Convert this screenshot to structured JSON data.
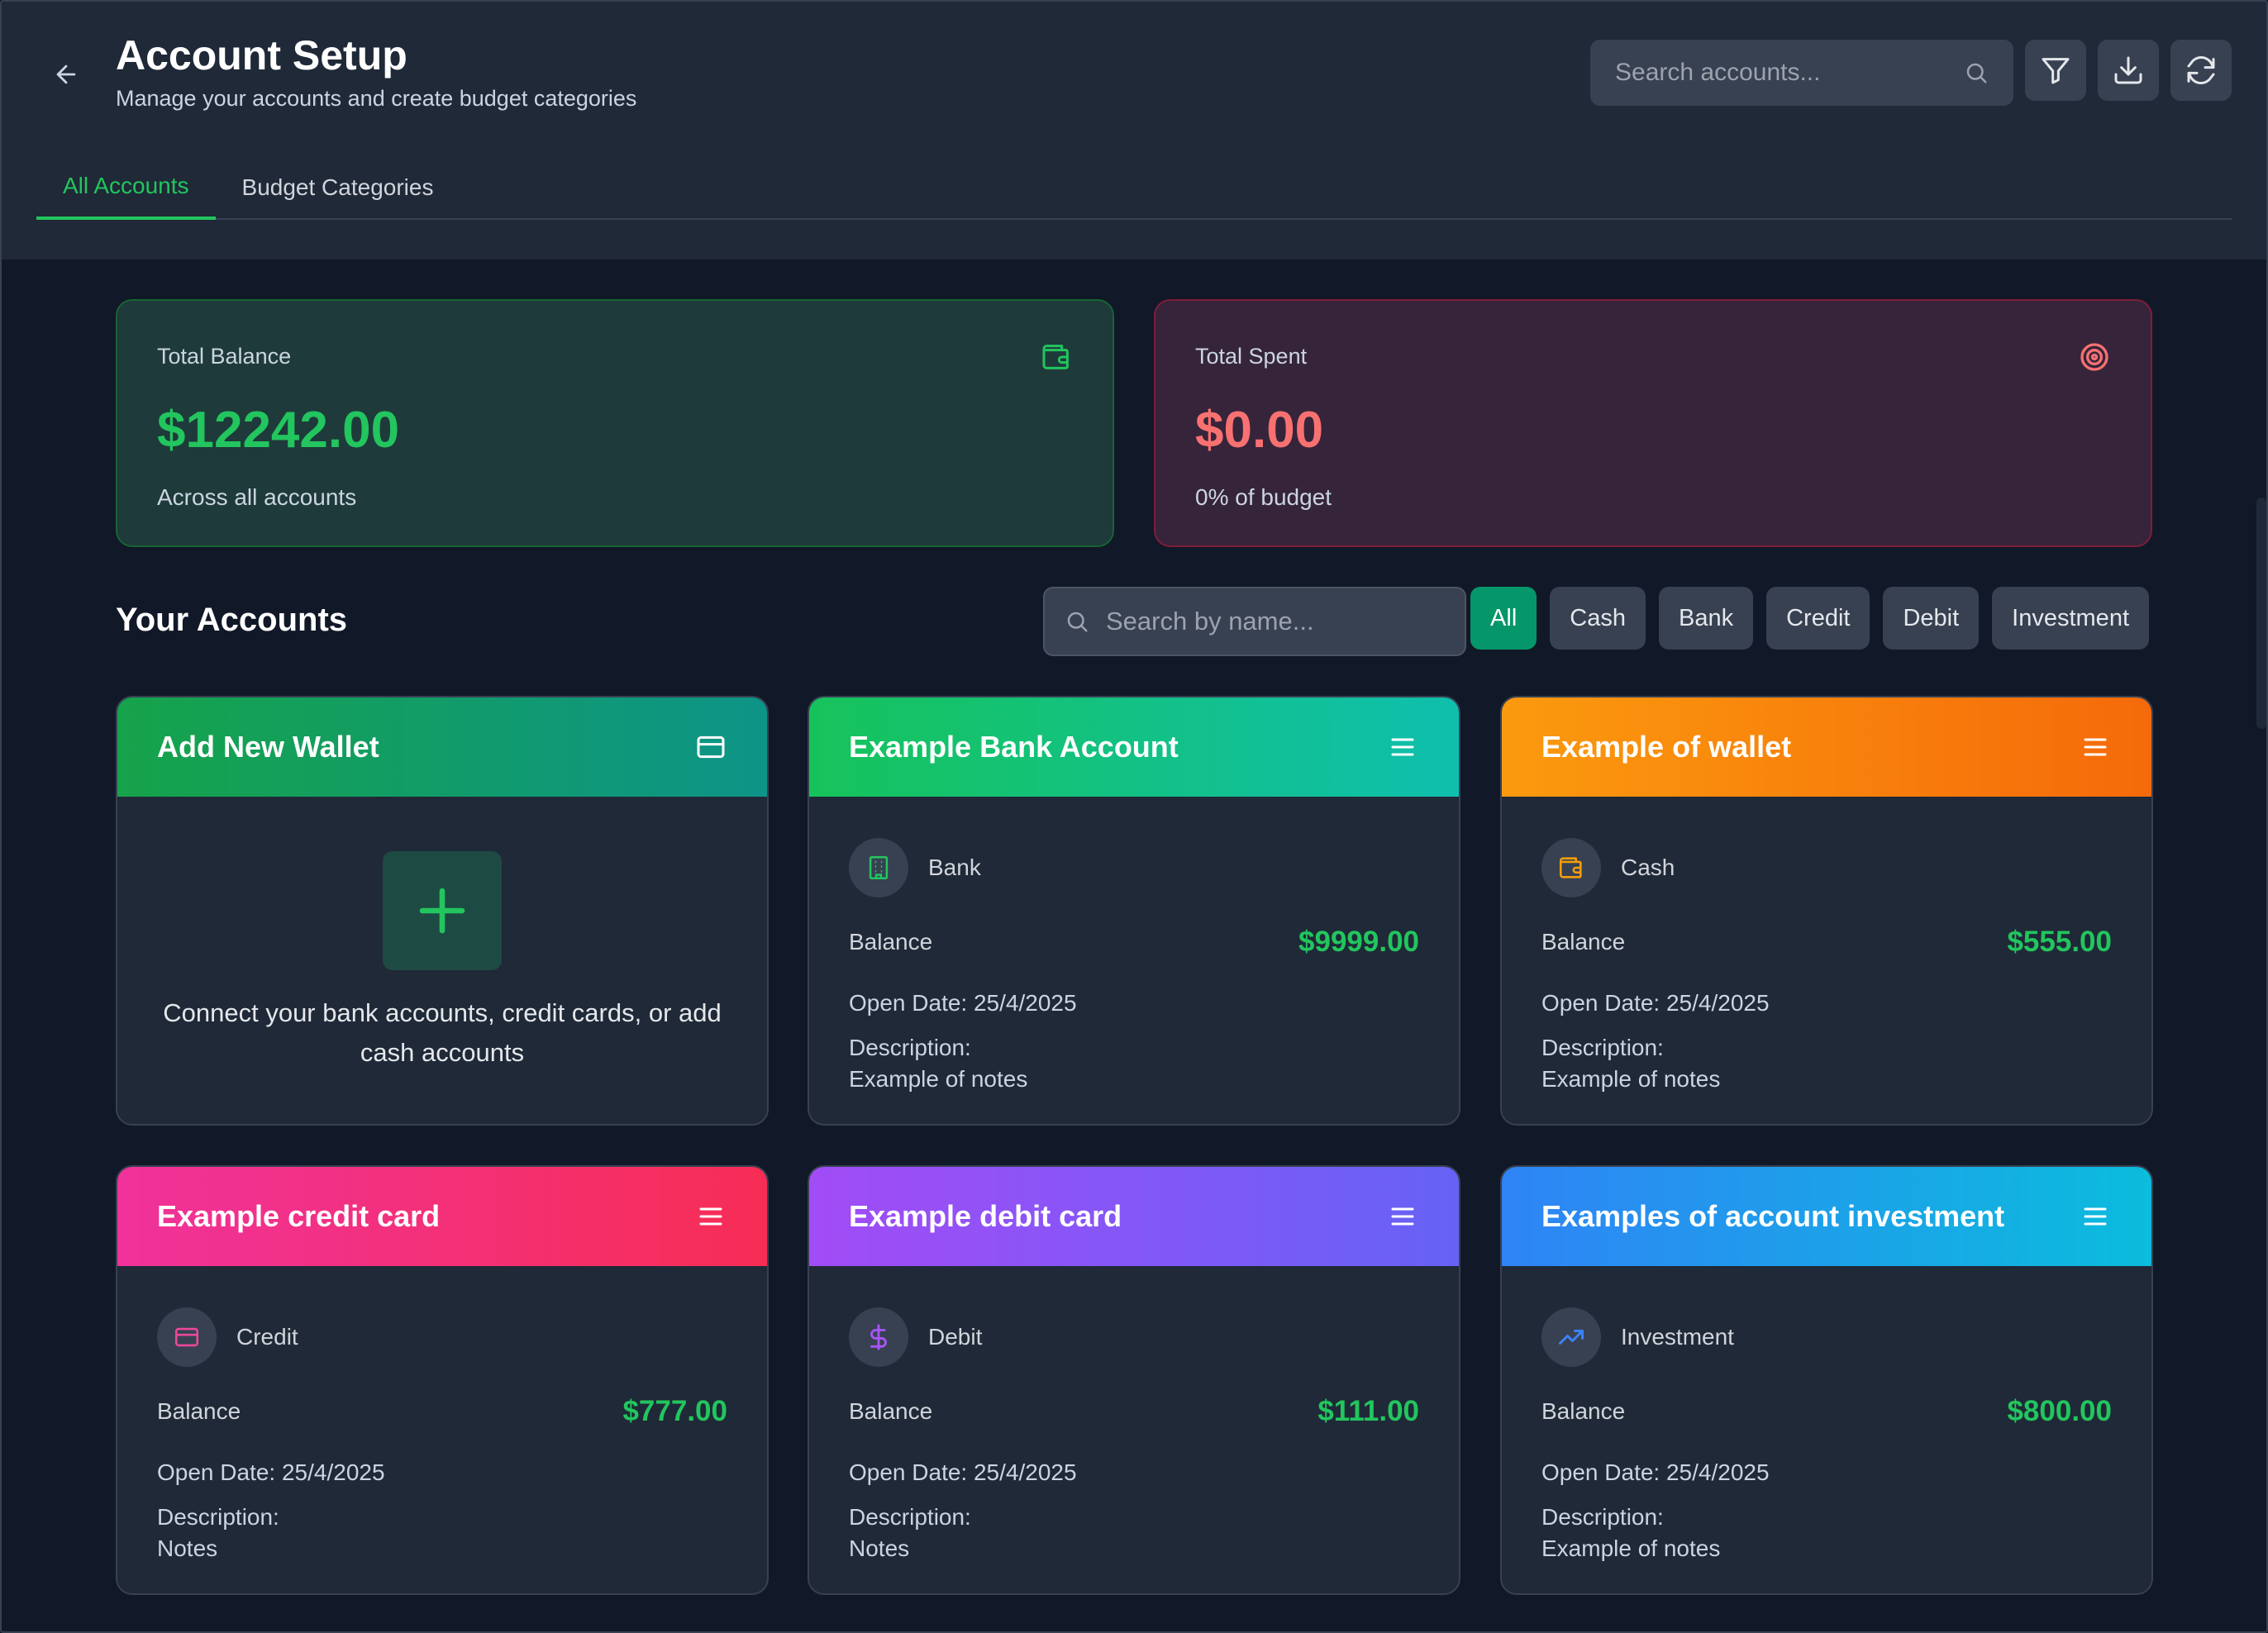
{
  "header": {
    "title": "Account Setup",
    "subtitle": "Manage your accounts and create budget categories",
    "search_placeholder": "Search accounts...",
    "tabs": [
      {
        "label": "All Accounts",
        "active": true
      },
      {
        "label": "Budget Categories",
        "active": false
      }
    ],
    "icons": [
      "back-arrow-icon",
      "search-icon",
      "filter-icon",
      "download-icon",
      "refresh-icon"
    ]
  },
  "summary": {
    "balance": {
      "label": "Total Balance",
      "value": "$12242.00",
      "note": "Across all accounts",
      "icon": "wallet-icon",
      "color": "#22c55e"
    },
    "spent": {
      "label": "Total Spent",
      "value": "$0.00",
      "note": "0% of budget",
      "icon": "target-icon",
      "color": "#f87171"
    }
  },
  "accounts_section": {
    "title": "Your Accounts",
    "search_placeholder": "Search by name...",
    "filters": [
      {
        "label": "All",
        "active": true
      },
      {
        "label": "Cash",
        "active": false
      },
      {
        "label": "Bank",
        "active": false
      },
      {
        "label": "Credit",
        "active": false
      },
      {
        "label": "Debit",
        "active": false
      },
      {
        "label": "Investment",
        "active": false
      }
    ]
  },
  "add_wallet": {
    "title": "Add New Wallet",
    "text": "Connect your bank accounts, credit cards, or add cash accounts",
    "icon": "card-icon",
    "gradient": [
      "#16a34a",
      "#0d9488"
    ]
  },
  "accounts": [
    {
      "title": "Example Bank Account",
      "type": "Bank",
      "balance_label": "Balance",
      "balance": "$9999.00",
      "open_date": "Open Date: 25/4/2025",
      "desc_label": "Description:",
      "desc": "Example of notes",
      "icon": "building-icon",
      "icon_color": "#22c55e",
      "gradient": [
        "#16c35a",
        "#0fbfae"
      ]
    },
    {
      "title": "Example of wallet",
      "type": "Cash",
      "balance_label": "Balance",
      "balance": "$555.00",
      "open_date": "Open Date: 25/4/2025",
      "desc_label": "Description:",
      "desc": "Example of notes",
      "icon": "wallet-icon",
      "icon_color": "#f59e0b",
      "gradient": [
        "#fb9a0e",
        "#f56a0a"
      ]
    },
    {
      "title": "Example credit card",
      "type": "Credit",
      "balance_label": "Balance",
      "balance": "$777.00",
      "open_date": "Open Date: 25/4/2025",
      "desc_label": "Description:",
      "desc": "Notes",
      "icon": "credit-card-icon",
      "icon_color": "#ec4899",
      "gradient": [
        "#f0329b",
        "#f72d55"
      ]
    },
    {
      "title": "Example debit card",
      "type": "Debit",
      "balance_label": "Balance",
      "balance": "$111.00",
      "open_date": "Open Date: 25/4/2025",
      "desc_label": "Description:",
      "desc": "Notes",
      "icon": "dollar-icon",
      "icon_color": "#a855f7",
      "gradient": [
        "#a24cf6",
        "#6662f5"
      ]
    },
    {
      "title": "Examples of account investment",
      "type": "Investment",
      "balance_label": "Balance",
      "balance": "$800.00",
      "open_date": "Open Date: 25/4/2025",
      "desc_label": "Description:",
      "desc": "Example of notes",
      "icon": "trend-up-icon",
      "icon_color": "#3b82f6",
      "gradient": [
        "#2f84f6",
        "#0bbcdc"
      ]
    }
  ]
}
